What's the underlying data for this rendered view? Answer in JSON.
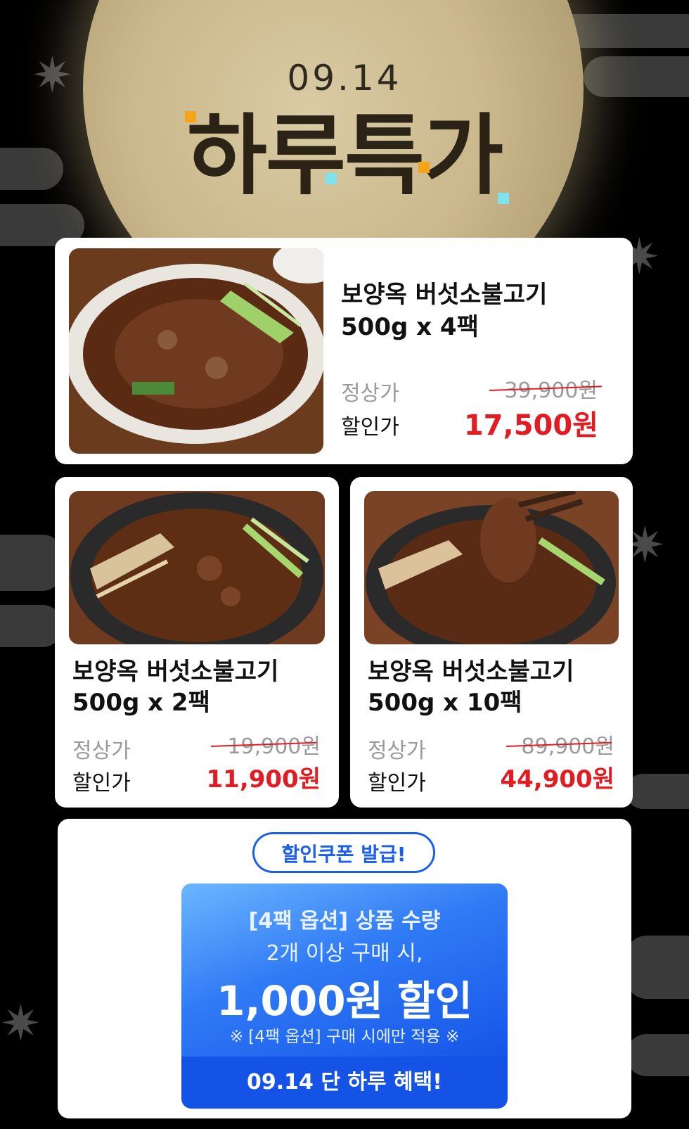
{
  "header": {
    "date": "09.14",
    "title": "하루특가"
  },
  "colors": {
    "price_red": "#e21c22",
    "accent_blue": "#1a5ef0",
    "accent_orange": "#f6a51a",
    "accent_cyan": "#7fe3ee"
  },
  "products": [
    {
      "name_line1": "보양옥 버섯소불고기",
      "name_line2": "500g x 4팩",
      "regular_label": "정상가",
      "regular_price": "39,900원",
      "sale_label": "할인가",
      "sale_price": "17,500원"
    },
    {
      "name_line1": "보양옥 버섯소불고기",
      "name_line2": "500g x 2팩",
      "regular_label": "정상가",
      "regular_price": "19,900원",
      "sale_label": "할인가",
      "sale_price": "11,900원"
    },
    {
      "name_line1": "보양옥 버섯소불고기",
      "name_line2": "500g x 10팩",
      "regular_label": "정상가",
      "regular_price": "89,900원",
      "sale_label": "할인가",
      "sale_price": "44,900원"
    }
  ],
  "coupon": {
    "badge": "할인쿠폰 발급!",
    "line1": "[4팩 옵션] 상품 수량",
    "line2": "2개 이상 구매 시,",
    "line3": "1,000원 할인",
    "note": "※ [4팩 옵션] 구매 시에만 적용 ※",
    "button": "09.14 단 하루 혜택!"
  }
}
